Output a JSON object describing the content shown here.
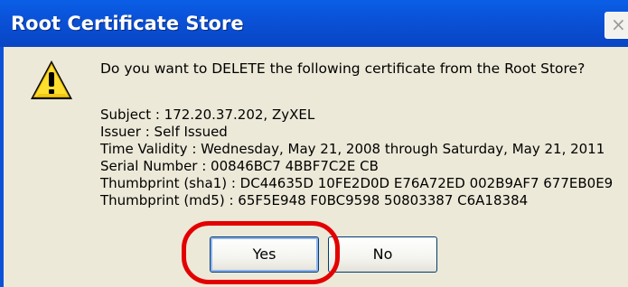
{
  "window": {
    "title": "Root Certificate Store",
    "close_glyph": "×"
  },
  "dialog": {
    "icon": "warning-icon",
    "message": "Do you want to DELETE the following certificate from the Root Store?",
    "details": {
      "subject": "Subject : 172.20.37.202, ZyXEL",
      "issuer": "Issuer : Self Issued",
      "validity": "Time Validity : Wednesday, May 21, 2008 through Saturday, May 21, 2011",
      "serial": "Serial Number : 00846BC7 4BBF7C2E CB",
      "thumb_sha1": "Thumbprint (sha1) : DC44635D 10FE2D0D E76A72ED 002B9AF7 677EB0E9",
      "thumb_md5": "Thumbprint (md5) : 65F5E948 F0BC9598 50803387 C6A18384"
    }
  },
  "buttons": {
    "yes": "Yes",
    "no": "No"
  },
  "colors": {
    "titlebar": "#0a52d8",
    "dialog_bg": "#ece9d8",
    "highlight": "#e30000"
  }
}
